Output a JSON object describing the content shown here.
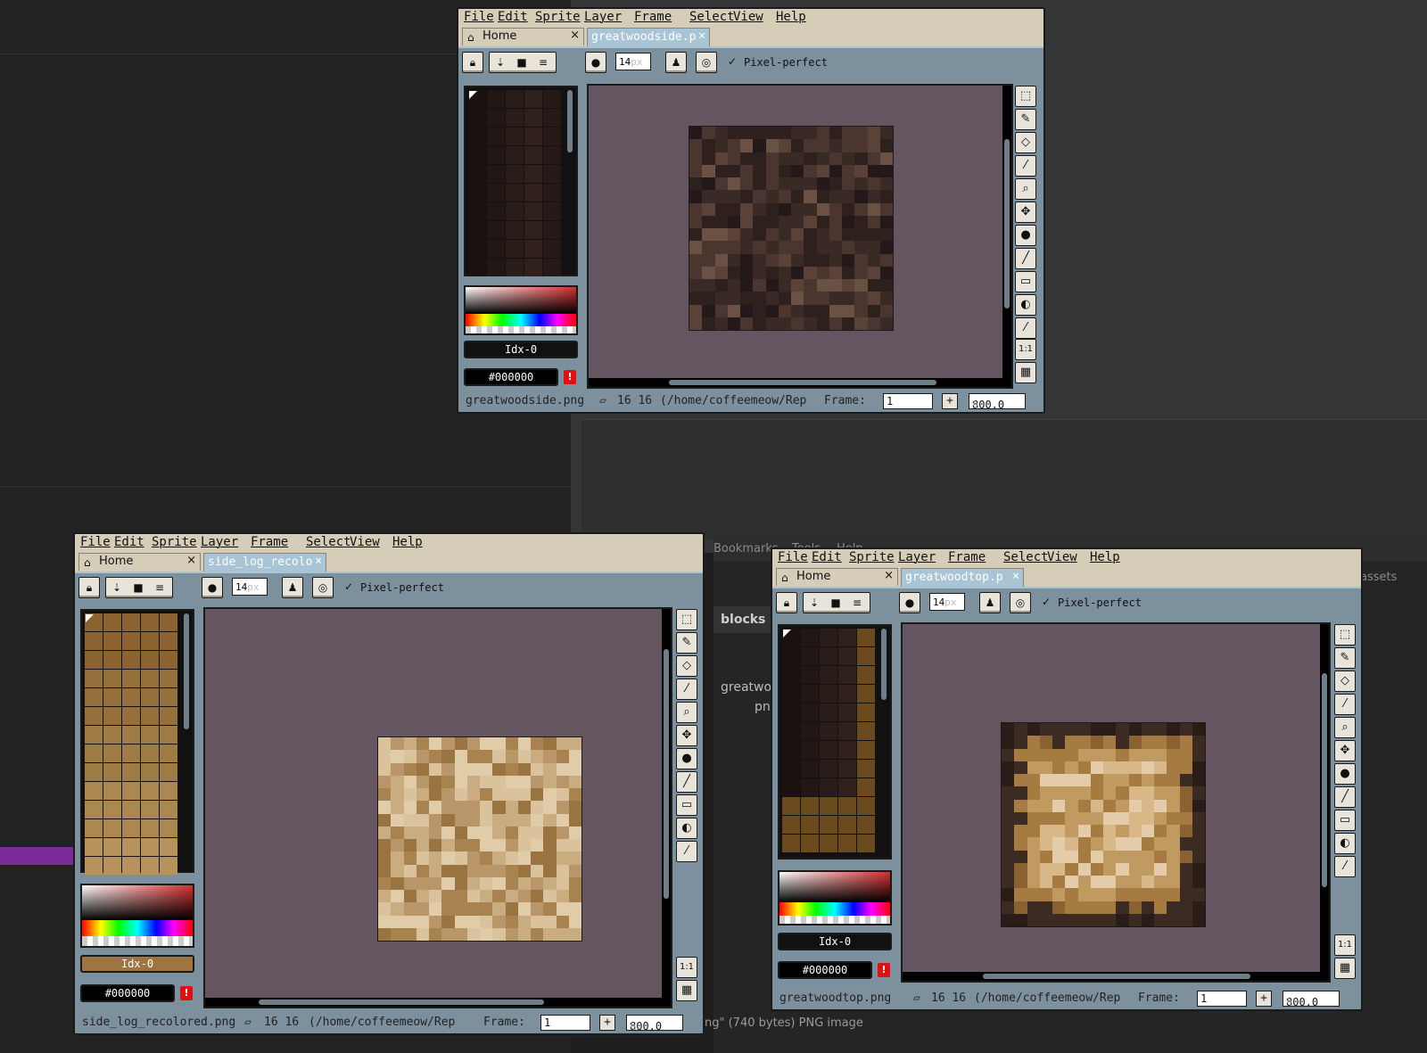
{
  "menu": [
    "File",
    "Edit",
    "Sprite",
    "Layer",
    "Frame",
    "Select",
    "View",
    "Help"
  ],
  "home_tab": {
    "label": "Home",
    "close": "×"
  },
  "toolbar": {
    "brush_size": "14",
    "brush_unit": "px",
    "pixel_perfect_check": "✓",
    "pixel_perfect_label": "Pixel-perfect"
  },
  "statusbar": {
    "frame_label": "Frame:",
    "frame_value": "1",
    "plus": "+"
  },
  "background_app": {
    "header_items": [
      "Bookmarks",
      "Tools",
      "Help"
    ],
    "section": "blocks",
    "file_label_line1": "greatwo",
    "file_label_line2": "pn",
    "assets_label": "assets",
    "status_text": "ng\" (740 bytes) PNG image"
  },
  "windows": [
    {
      "id": "side",
      "tab_label": "greatwoodside.p",
      "tab_close": "×",
      "idx_label": "Idx-0",
      "color_hex": "#000000",
      "warn": "!",
      "status_filename": "greatwoodside.png",
      "status_size_icon": "▱",
      "status_dims": "16 16",
      "status_path": "(/home/coffeemeow/Rep",
      "zoom": "800.0",
      "zoom_unit": "%",
      "palette_colors": [
        "#1a1110",
        "#221714",
        "#2a1d19",
        "#2f201c",
        "#271a16"
      ],
      "pixel_palette": [
        "#2e211d",
        "#3a2a25",
        "#4a362f",
        "#5a4239",
        "#6b5044",
        "#24191a"
      ]
    },
    {
      "id": "log",
      "tab_label": "side_log_recolo",
      "tab_close": "×",
      "idx_label": "Idx-0",
      "color_hex": "#000000",
      "warn": "!",
      "status_filename": "side_log_recolored.png",
      "status_size_icon": "▱",
      "status_dims": "16 16",
      "status_path": "(/home/coffeemeow/Rep",
      "zoom": "800.0",
      "zoom_unit": "%",
      "palette_colors": [
        "#8c6530",
        "#9a7038",
        "#a77c42",
        "#b48a4c",
        "#a07440"
      ],
      "pixel_palette": [
        "#d9c29c",
        "#c9ad80",
        "#b8966a",
        "#a8834f",
        "#9a7440",
        "#e0cca8"
      ]
    },
    {
      "id": "top",
      "tab_label": "greatwoodtop.p",
      "tab_close": "×",
      "idx_label": "Idx-0",
      "color_hex": "#000000",
      "warn": "!",
      "status_filename": "greatwoodtop.png",
      "status_size_icon": "▱",
      "status_dims": "16 16",
      "status_path": "(/home/coffeemeow/Rep",
      "zoom": "800.0",
      "zoom_unit": "%",
      "palette_colors": [
        "#1a1110",
        "#221714",
        "#2a1d19",
        "#2f201c",
        "#6b4a1e"
      ],
      "pixel_palette": [
        "#2a1d18",
        "#3c2b22",
        "#8a6232",
        "#a57b42",
        "#c19a62",
        "#d8b888",
        "#e4ccaa"
      ]
    }
  ]
}
